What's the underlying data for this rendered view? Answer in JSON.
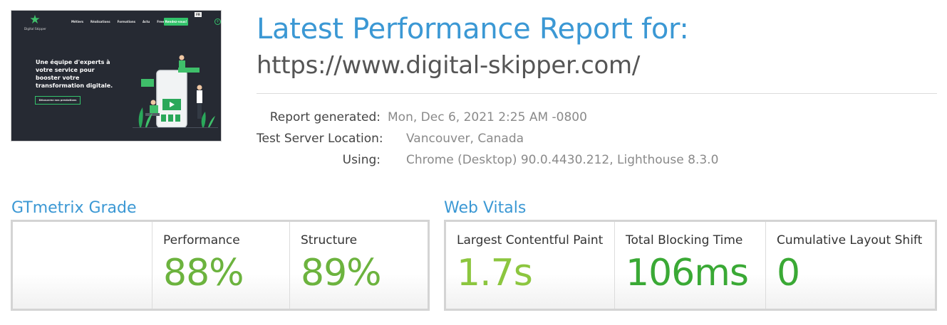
{
  "thumbnail": {
    "logo_text": "Digital Skipper",
    "nav_items": [
      "Métiers",
      "Réalisations",
      "Formations",
      "Actu",
      "Freelances"
    ],
    "cta_label": "Rendez-vous!",
    "lang_label": "FR",
    "headline": "Une équipe d'experts à votre service pour booster votre transformation digitale.",
    "button_label": "Découvrez nos prestations"
  },
  "header": {
    "title": "Latest Performance Report for:",
    "url": "https://www.digital-skipper.com/"
  },
  "meta": {
    "report_generated_label": "Report generated:",
    "report_generated_value": "Mon, Dec 6, 2021 2:25 AM -0800",
    "server_location_label": "Test Server Location:",
    "server_location_value": "Vancouver, Canada",
    "using_label": "Using:",
    "using_value": "Chrome (Desktop) 90.0.4430.212, Lighthouse 8.3.0"
  },
  "gtmetrix": {
    "section_title": "GTmetrix Grade",
    "performance_label": "Performance",
    "performance_value": "88%",
    "structure_label": "Structure",
    "structure_value": "89%"
  },
  "web_vitals": {
    "section_title": "Web Vitals",
    "lcp_label": "Largest Contentful Paint",
    "lcp_value": "1.7s",
    "tbt_label": "Total Blocking Time",
    "tbt_value": "106ms",
    "cls_label": "Cumulative Layout Shift",
    "cls_value": "0"
  },
  "colors": {
    "accent_blue": "#3b98d4",
    "grade_green": "#6cb33e",
    "vital_light_green": "#8cc63f",
    "vital_dark_green": "#3aa935"
  }
}
